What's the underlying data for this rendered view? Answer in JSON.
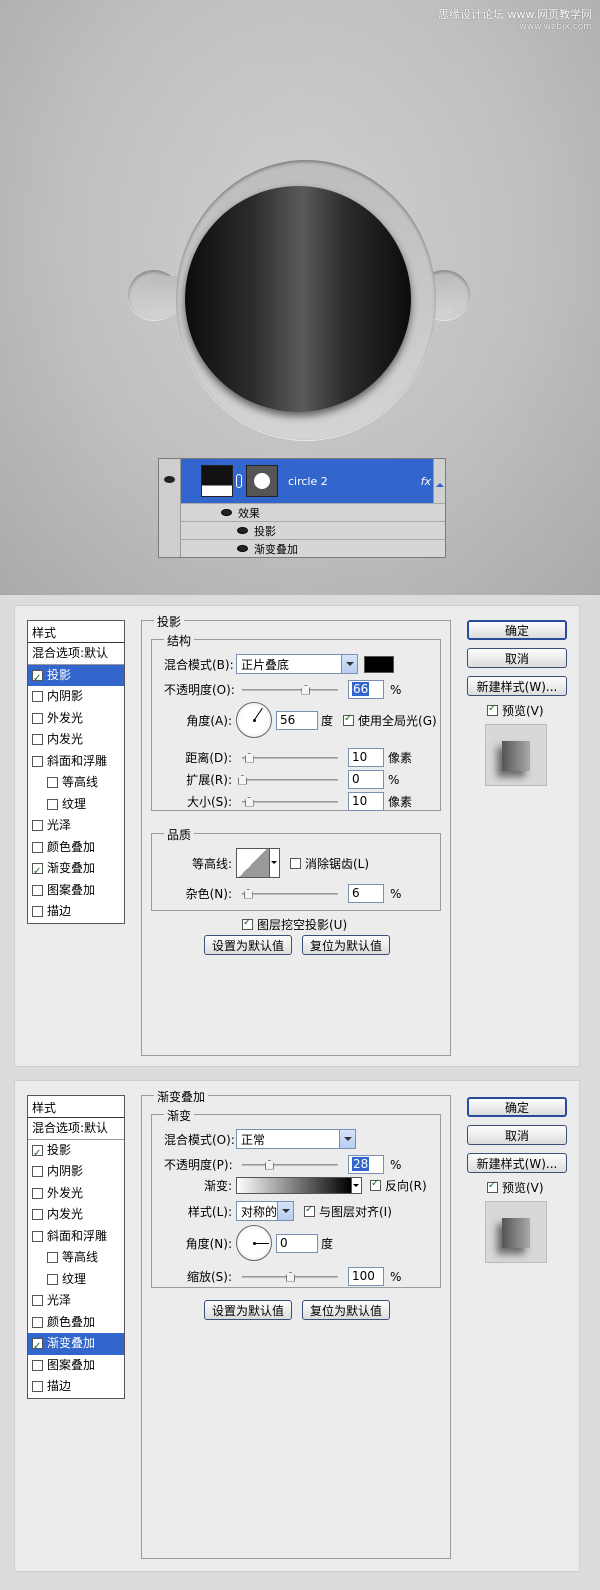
{
  "watermark": {
    "line1": "思缘设计论坛 www.网页教学网",
    "line2": "www.webjx.com"
  },
  "layers": {
    "layer_name": "circle 2",
    "fx": "fx",
    "effects_label": "效果",
    "effects": [
      "投影",
      "渐变叠加"
    ]
  },
  "dialog1": {
    "style_header": "样式",
    "styles": [
      {
        "label": "混合选项:默认",
        "checkbox": false,
        "checked": false,
        "indent": false,
        "selected": false
      },
      {
        "label": "投影",
        "checkbox": true,
        "checked": true,
        "indent": false,
        "selected": true
      },
      {
        "label": "内阴影",
        "checkbox": true,
        "checked": false,
        "indent": false,
        "selected": false
      },
      {
        "label": "外发光",
        "checkbox": true,
        "checked": false,
        "indent": false,
        "selected": false
      },
      {
        "label": "内发光",
        "checkbox": true,
        "checked": false,
        "indent": false,
        "selected": false
      },
      {
        "label": "斜面和浮雕",
        "checkbox": true,
        "checked": false,
        "indent": false,
        "selected": false
      },
      {
        "label": "等高线",
        "checkbox": true,
        "checked": false,
        "indent": true,
        "selected": false
      },
      {
        "label": "纹理",
        "checkbox": true,
        "checked": false,
        "indent": true,
        "selected": false
      },
      {
        "label": "光泽",
        "checkbox": true,
        "checked": false,
        "indent": false,
        "selected": false
      },
      {
        "label": "颜色叠加",
        "checkbox": true,
        "checked": false,
        "indent": false,
        "selected": false
      },
      {
        "label": "渐变叠加",
        "checkbox": true,
        "checked": true,
        "indent": false,
        "selected": false
      },
      {
        "label": "图案叠加",
        "checkbox": true,
        "checked": false,
        "indent": false,
        "selected": false
      },
      {
        "label": "描边",
        "checkbox": true,
        "checked": false,
        "indent": false,
        "selected": false
      }
    ],
    "panel_title": "投影",
    "structure_title": "结构",
    "blend_mode_label": "混合模式(B):",
    "blend_mode_value": "正片叠底",
    "opacity_label": "不透明度(O):",
    "opacity_value": "66",
    "opacity_level": 0.66,
    "angle_label": "角度(A):",
    "angle_value": "56",
    "angle_unit": "度",
    "global_light_label": "使用全局光(G)",
    "distance_label": "距离(D):",
    "distance_value": "10",
    "distance_level": 0.07,
    "spread_label": "扩展(R):",
    "spread_value": "0",
    "spread_level": 0.0,
    "size_label": "大小(S):",
    "size_value": "10",
    "size_level": 0.07,
    "px_unit": "像素",
    "pct_unit": "%",
    "quality_title": "品质",
    "contour_label": "等高线:",
    "antialias_label": "消除锯齿(L)",
    "noise_label": "杂色(N):",
    "noise_value": "6",
    "noise_level": 0.06,
    "knockout_label": "图层挖空投影(U)",
    "make_default": "设置为默认值",
    "reset_default": "复位为默认值",
    "ok": "确定",
    "cancel": "取消",
    "new_style": "新建样式(W)...",
    "preview_label": "预览(V)"
  },
  "dialog2": {
    "style_header": "样式",
    "styles": [
      {
        "label": "混合选项:默认",
        "checkbox": false,
        "checked": false,
        "indent": false,
        "selected": false
      },
      {
        "label": "投影",
        "checkbox": true,
        "checked": true,
        "indent": false,
        "selected": false
      },
      {
        "label": "内阴影",
        "checkbox": true,
        "checked": false,
        "indent": false,
        "selected": false
      },
      {
        "label": "外发光",
        "checkbox": true,
        "checked": false,
        "indent": false,
        "selected": false
      },
      {
        "label": "内发光",
        "checkbox": true,
        "checked": false,
        "indent": false,
        "selected": false
      },
      {
        "label": "斜面和浮雕",
        "checkbox": true,
        "checked": false,
        "indent": false,
        "selected": false
      },
      {
        "label": "等高线",
        "checkbox": true,
        "checked": false,
        "indent": true,
        "selected": false
      },
      {
        "label": "纹理",
        "checkbox": true,
        "checked": false,
        "indent": true,
        "selected": false
      },
      {
        "label": "光泽",
        "checkbox": true,
        "checked": false,
        "indent": false,
        "selected": false
      },
      {
        "label": "颜色叠加",
        "checkbox": true,
        "checked": false,
        "indent": false,
        "selected": false
      },
      {
        "label": "渐变叠加",
        "checkbox": true,
        "checked": true,
        "indent": false,
        "selected": true
      },
      {
        "label": "图案叠加",
        "checkbox": true,
        "checked": false,
        "indent": false,
        "selected": false
      },
      {
        "label": "描边",
        "checkbox": true,
        "checked": false,
        "indent": false,
        "selected": false
      }
    ],
    "panel_title": "渐变叠加",
    "gradient_title": "渐变",
    "blend_mode_label": "混合模式(O):",
    "blend_mode_value": "正常",
    "opacity_label": "不透明度(P):",
    "opacity_value": "28",
    "opacity_level": 0.28,
    "gradient_label": "渐变:",
    "reverse_label": "反向(R)",
    "style_label": "样式(L):",
    "style_value": "对称的",
    "align_label": "与图层对齐(I)",
    "angle_label": "角度(N):",
    "angle_value": "0",
    "angle_unit": "度",
    "scale_label": "缩放(S):",
    "scale_value": "100",
    "scale_level": 0.5,
    "pct_unit": "%",
    "make_default": "设置为默认值",
    "reset_default": "复位为默认值",
    "ok": "确定",
    "cancel": "取消",
    "new_style": "新建样式(W)...",
    "preview_label": "预览(V)"
  }
}
